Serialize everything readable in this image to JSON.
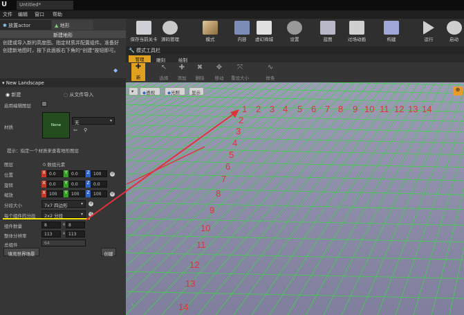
{
  "app": {
    "doc_tab": "Untitled*",
    "menu": [
      "文件",
      "编辑",
      "窗口",
      "帮助"
    ]
  },
  "left_panel": {
    "tabs": [
      "放置actor",
      "地形"
    ],
    "new_terrain_header": "新建地形",
    "hint": "创建或导入新的高度图。指定材质并配置组件。准备好创建新地图时，按下此面板右下角的\"创建\"按钮即可。",
    "section_title": "New Landscape",
    "radio_new": "新建",
    "radio_import": "从文件导入",
    "editable_layers_label": "启用编辑图层",
    "material_label": "材质",
    "material_thumb_text": "None",
    "material_value": "无",
    "material_tip": "提示：指定一个材质来查看地形图层",
    "layers_label": "图层",
    "layers_value": "0 数组元素",
    "location_label": "位置",
    "location": {
      "x": "0.0",
      "y": "0.0",
      "z": "100"
    },
    "rotation_label": "旋转",
    "rotation": {
      "x": "0.0",
      "y": "0.0",
      "z": "0.0"
    },
    "scale_label": "缩放",
    "scale": {
      "x": "100",
      "y": "100",
      "z": "100"
    },
    "section_size_label": "分段大小",
    "section_size_value": "7x7 四边形",
    "sections_per_comp_label": "每个组件的分段",
    "sections_per_comp_value": "2x2 分段",
    "component_count_label": "组件数量",
    "component_count": {
      "x": "8",
      "y": "8"
    },
    "overall_res_label": "整体分辨率",
    "overall_res": {
      "x": "113",
      "y": "113"
    },
    "total_components_label": "总组件",
    "total_components_value": "64",
    "fill_world_button": "填充世界场景",
    "create_button": "创建"
  },
  "toolbar": {
    "items": [
      {
        "label": "保存当前关卡",
        "icon": "save-icon"
      },
      {
        "label": "源码管理",
        "icon": "source-control-icon"
      },
      {
        "label": "模式",
        "icon": "modes-icon"
      },
      {
        "label": "内容",
        "icon": "content-icon"
      },
      {
        "label": "虚幻商城",
        "icon": "marketplace-icon"
      },
      {
        "label": "设置",
        "icon": "settings-icon"
      },
      {
        "label": "蓝图",
        "icon": "blueprints-icon"
      },
      {
        "label": "过场动画",
        "icon": "cinematics-icon"
      },
      {
        "label": "构建",
        "icon": "build-icon"
      },
      {
        "label": "运行",
        "icon": "play-icon"
      },
      {
        "label": "启动",
        "icon": "launch-icon"
      }
    ]
  },
  "mode_bar": {
    "title": "模式工具栏",
    "tabs": [
      "管理",
      "雕刻",
      "绘制"
    ],
    "actions": [
      "新",
      "选择",
      "添加",
      "删除",
      "移动",
      "重设大小",
      "样条"
    ]
  },
  "viewport": {
    "buttons": [
      "透视",
      "光照",
      "显示"
    ],
    "row_numbers": [
      "1",
      "2",
      "3",
      "4",
      "5",
      "6",
      "7",
      "8",
      "9",
      "10",
      "11",
      "12",
      "13",
      "14"
    ],
    "col_numbers": [
      "2",
      "3",
      "4",
      "5",
      "6",
      "7",
      "8",
      "9",
      "10",
      "11",
      "12",
      "13",
      "14"
    ]
  },
  "colors": {
    "grid_line": "#3fd24a",
    "annotation": "#e0323a",
    "highlight_underline": "#f2e600",
    "viewport_bg": "#8d8da9"
  }
}
